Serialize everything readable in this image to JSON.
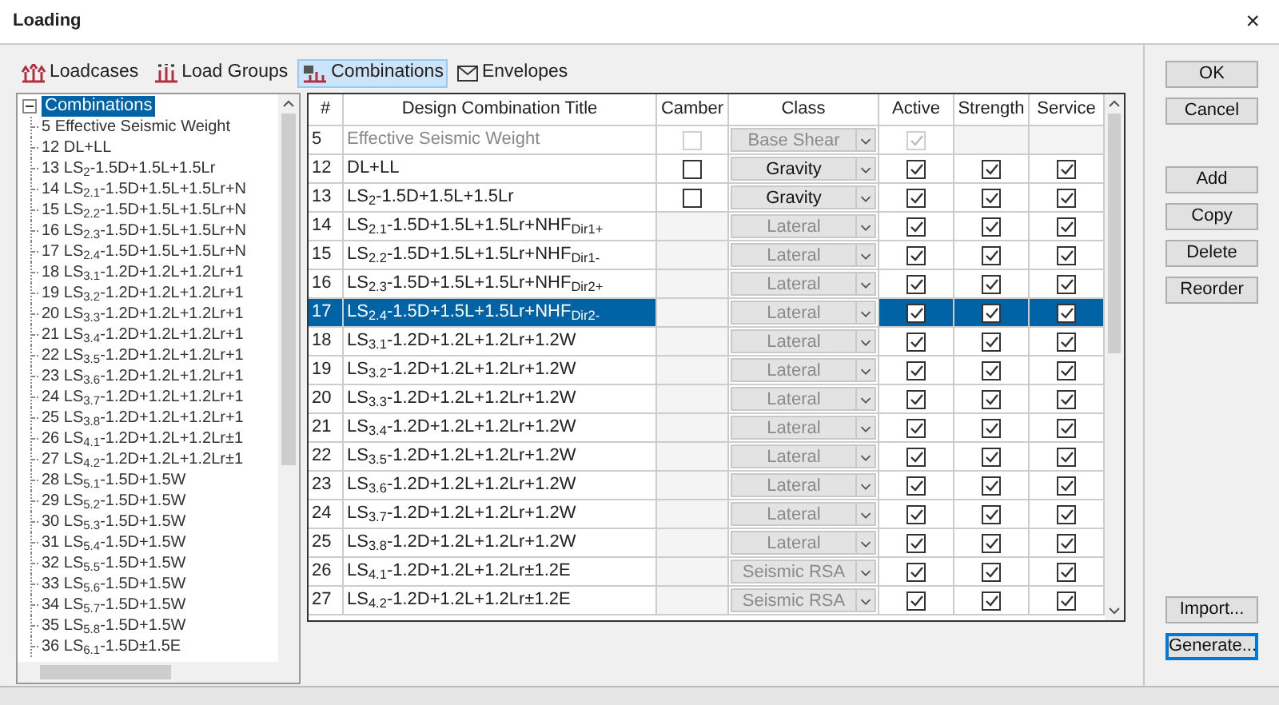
{
  "window": {
    "title": "Loading",
    "close": "×"
  },
  "tabs": [
    {
      "label": "Loadcases",
      "selected": false,
      "kind": "loadcase"
    },
    {
      "label": "Load Groups",
      "selected": false,
      "kind": "group"
    },
    {
      "label": "Combinations",
      "selected": true,
      "kind": "combination"
    },
    {
      "label": "Envelopes",
      "selected": false,
      "kind": "envelope"
    }
  ],
  "tree": {
    "root": {
      "label": "Combinations",
      "selected": true,
      "expanded": true,
      "children": [
        {
          "label": "5 Effective Seismic Weight"
        },
        {
          "label": "12 DL+LL"
        },
        {
          "label": "13 LS$_{2}$-1.5D+1.5L+1.5Lr"
        },
        {
          "label": "14 LS$_{2.1}$-1.5D+1.5L+1.5Lr+N"
        },
        {
          "label": "15 LS$_{2.2}$-1.5D+1.5L+1.5Lr+N"
        },
        {
          "label": "16 LS$_{2.3}$-1.5D+1.5L+1.5Lr+N"
        },
        {
          "label": "17 LS$_{2.4}$-1.5D+1.5L+1.5Lr+N"
        },
        {
          "label": "18 LS$_{3.1}$-1.2D+1.2L+1.2Lr+1"
        },
        {
          "label": "19 LS$_{3.2}$-1.2D+1.2L+1.2Lr+1"
        },
        {
          "label": "20 LS$_{3.3}$-1.2D+1.2L+1.2Lr+1"
        },
        {
          "label": "21 LS$_{3.4}$-1.2D+1.2L+1.2Lr+1"
        },
        {
          "label": "22 LS$_{3.5}$-1.2D+1.2L+1.2Lr+1"
        },
        {
          "label": "23 LS$_{3.6}$-1.2D+1.2L+1.2Lr+1"
        },
        {
          "label": "24 LS$_{3.7}$-1.2D+1.2L+1.2Lr+1"
        },
        {
          "label": "25 LS$_{3.8}$-1.2D+1.2L+1.2Lr+1"
        },
        {
          "label": "26 LS$_{4.1}$-1.2D+1.2L+1.2Lr±1"
        },
        {
          "label": "27 LS$_{4.2}$-1.2D+1.2L+1.2Lr±1"
        },
        {
          "label": "28 LS$_{5.1}$-1.5D+1.5W"
        },
        {
          "label": "29 LS$_{5.2}$-1.5D+1.5W"
        },
        {
          "label": "30 LS$_{5.3}$-1.5D+1.5W"
        },
        {
          "label": "31 LS$_{5.4}$-1.5D+1.5W"
        },
        {
          "label": "32 LS$_{5.5}$-1.5D+1.5W"
        },
        {
          "label": "33 LS$_{5.6}$-1.5D+1.5W"
        },
        {
          "label": "34 LS$_{5.7}$-1.5D+1.5W"
        },
        {
          "label": "35 LS$_{5.8}$-1.5D+1.5W"
        },
        {
          "label": "36 LS$_{6.1}$-1.5D±1.5E"
        }
      ]
    }
  },
  "table": {
    "columns": [
      "#",
      "Design Combination Title",
      "Camber",
      "Class",
      "Active",
      "Strength",
      "Service"
    ],
    "rows": [
      {
        "number": "5",
        "title": "Effective Seismic Weight",
        "disabled": true,
        "selected": false,
        "camber": {
          "checked": false,
          "disabled": true
        },
        "class": "Base Shear",
        "class_enabled": false,
        "active": {
          "checked": true,
          "disabled": true
        }
      },
      {
        "number": "12",
        "title": "DL+LL",
        "disabled": false,
        "selected": false,
        "camber": {
          "checked": false,
          "disabled": false
        },
        "class": "Gravity",
        "class_enabled": true,
        "active": {
          "checked": true,
          "disabled": false
        },
        "strength": {
          "checked": true
        },
        "service": {
          "checked": true
        }
      },
      {
        "number": "13",
        "title": "LS$_{2}$-1.5D+1.5L+1.5Lr",
        "disabled": false,
        "selected": false,
        "camber": {
          "checked": false,
          "disabled": false
        },
        "class": "Gravity",
        "class_enabled": true,
        "active": {
          "checked": true,
          "disabled": false
        },
        "strength": {
          "checked": true
        },
        "service": {
          "checked": true
        }
      },
      {
        "number": "14",
        "title": "LS$_{2.1}$-1.5D+1.5L+1.5Lr+NHF$_{Dir1+}$",
        "disabled": false,
        "selected": false,
        "class": "Lateral",
        "class_enabled": false,
        "active": {
          "checked": true,
          "disabled": false
        },
        "strength": {
          "checked": true
        },
        "service": {
          "checked": true
        }
      },
      {
        "number": "15",
        "title": "LS$_{2.2}$-1.5D+1.5L+1.5Lr+NHF$_{Dir1-}$",
        "disabled": false,
        "selected": false,
        "class": "Lateral",
        "class_enabled": false,
        "active": {
          "checked": true,
          "disabled": false
        },
        "strength": {
          "checked": true
        },
        "service": {
          "checked": true
        }
      },
      {
        "number": "16",
        "title": "LS$_{2.3}$-1.5D+1.5L+1.5Lr+NHF$_{Dir2+}$",
        "disabled": false,
        "selected": false,
        "class": "Lateral",
        "class_enabled": false,
        "active": {
          "checked": true,
          "disabled": false
        },
        "strength": {
          "checked": true
        },
        "service": {
          "checked": true
        }
      },
      {
        "number": "17",
        "title": "LS$_{2.4}$-1.5D+1.5L+1.5Lr+NHF$_{Dir2-}$",
        "disabled": false,
        "selected": true,
        "class": "Lateral",
        "class_enabled": false,
        "active": {
          "checked": true,
          "disabled": false
        },
        "strength": {
          "checked": true
        },
        "service": {
          "checked": true
        }
      },
      {
        "number": "18",
        "title": "LS$_{3.1}$-1.2D+1.2L+1.2Lr+1.2W",
        "disabled": false,
        "selected": false,
        "class": "Lateral",
        "class_enabled": false,
        "active": {
          "checked": true,
          "disabled": false
        },
        "strength": {
          "checked": true
        },
        "service": {
          "checked": true
        }
      },
      {
        "number": "19",
        "title": "LS$_{3.2}$-1.2D+1.2L+1.2Lr+1.2W",
        "disabled": false,
        "selected": false,
        "class": "Lateral",
        "class_enabled": false,
        "active": {
          "checked": true,
          "disabled": false
        },
        "strength": {
          "checked": true
        },
        "service": {
          "checked": true
        }
      },
      {
        "number": "20",
        "title": "LS$_{3.3}$-1.2D+1.2L+1.2Lr+1.2W",
        "disabled": false,
        "selected": false,
        "class": "Lateral",
        "class_enabled": false,
        "active": {
          "checked": true,
          "disabled": false
        },
        "strength": {
          "checked": true
        },
        "service": {
          "checked": true
        }
      },
      {
        "number": "21",
        "title": "LS$_{3.4}$-1.2D+1.2L+1.2Lr+1.2W",
        "disabled": false,
        "selected": false,
        "class": "Lateral",
        "class_enabled": false,
        "active": {
          "checked": true,
          "disabled": false
        },
        "strength": {
          "checked": true
        },
        "service": {
          "checked": true
        }
      },
      {
        "number": "22",
        "title": "LS$_{3.5}$-1.2D+1.2L+1.2Lr+1.2W",
        "disabled": false,
        "selected": false,
        "class": "Lateral",
        "class_enabled": false,
        "active": {
          "checked": true,
          "disabled": false
        },
        "strength": {
          "checked": true
        },
        "service": {
          "checked": true
        }
      },
      {
        "number": "23",
        "title": "LS$_{3.6}$-1.2D+1.2L+1.2Lr+1.2W",
        "disabled": false,
        "selected": false,
        "class": "Lateral",
        "class_enabled": false,
        "active": {
          "checked": true,
          "disabled": false
        },
        "strength": {
          "checked": true
        },
        "service": {
          "checked": true
        }
      },
      {
        "number": "24",
        "title": "LS$_{3.7}$-1.2D+1.2L+1.2Lr+1.2W",
        "disabled": false,
        "selected": false,
        "class": "Lateral",
        "class_enabled": false,
        "active": {
          "checked": true,
          "disabled": false
        },
        "strength": {
          "checked": true
        },
        "service": {
          "checked": true
        }
      },
      {
        "number": "25",
        "title": "LS$_{3.8}$-1.2D+1.2L+1.2Lr+1.2W",
        "disabled": false,
        "selected": false,
        "class": "Lateral",
        "class_enabled": false,
        "active": {
          "checked": true,
          "disabled": false
        },
        "strength": {
          "checked": true
        },
        "service": {
          "checked": true
        }
      },
      {
        "number": "26",
        "title": "LS$_{4.1}$-1.2D+1.2L+1.2Lr±1.2E",
        "disabled": false,
        "selected": false,
        "class": "Seismic RSA",
        "class_enabled": false,
        "active": {
          "checked": true,
          "disabled": false
        },
        "strength": {
          "checked": true
        },
        "service": {
          "checked": true
        }
      },
      {
        "number": "27",
        "title": "LS$_{4.2}$-1.2D+1.2L+1.2Lr±1.2E",
        "disabled": false,
        "selected": false,
        "class": "Seismic RSA",
        "class_enabled": false,
        "active": {
          "checked": true,
          "disabled": false
        },
        "strength": {
          "checked": true
        },
        "service": {
          "checked": true
        }
      }
    ]
  },
  "buttons_top": [
    {
      "label": "OK"
    },
    {
      "label": "Cancel"
    }
  ],
  "buttons_middle": [
    {
      "label": "Add"
    },
    {
      "label": "Copy"
    },
    {
      "label": "Delete"
    },
    {
      "label": "Reorder"
    }
  ],
  "buttons_bottom": [
    {
      "label": "Import...",
      "focused": false
    },
    {
      "label": "Generate...",
      "focused": true
    }
  ]
}
